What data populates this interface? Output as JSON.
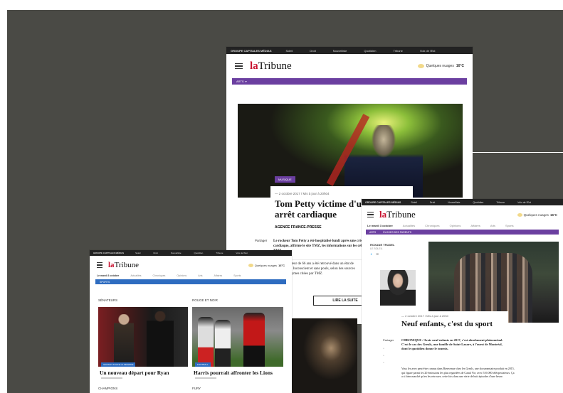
{
  "big": {
    "top_group": "GROUPE CAPITALES MÉDIAS",
    "top_links": [
      "Soleil",
      "Droit",
      "Nouvelliste",
      "Quotidien",
      "Tribune",
      "Voix de l'Est"
    ],
    "logo_la": "la",
    "logo_tribune": "Tribune",
    "weather": "Quelques nuages",
    "temp": "16°C",
    "section": "ARTS",
    "tag": "MUSIQUE",
    "date": "— 2 octobre 2017 / Mis à jour à 20h04",
    "title": "Tom Petty victime d'un arrêt cardiaque",
    "agency": "AGENCE FRANCE-PRESSE",
    "share": "Partager",
    "lead": "Le rockeur Tom Petty a été hospitalisé lundi après une crise cardiaque, affirme le site TMZ, les informations sur les célébrités TMZ.",
    "para": "chanteur de 66 ans a été retrouvé dans un état de arrêt. Inconscient et sans pouls, selon des sources anonymes citées par TMZ.",
    "button": "LIRE LA SUITE"
  },
  "left": {
    "top_group": "GROUPE CAPITALES MÉDIAS",
    "top_links": [
      "Soleil",
      "Droit",
      "Nouvelliste",
      "Quotidien",
      "Tribune",
      "Voix de l'Est"
    ],
    "logo_la": "la",
    "logo_tribune": "Tribune",
    "weather": "Quelques nuages",
    "temp": "16°C",
    "nav": [
      "Le mardi 3 octobre",
      "Actualités",
      "Chroniques",
      "Opinions",
      "Arts",
      "Affaires",
      "Sports"
    ],
    "section": "SPORTS",
    "col1_label": "SÉNATEURS",
    "col2_label": "ROUGE ET NOIR",
    "card1_tag": "GRATUIT TOUTE LA SEMAINE",
    "card2_tag": "FOOTBALL",
    "card1_title": "Un nouveau départ pour Ryan",
    "card2_title": "Harris pourrait affronter les Lions",
    "col1_bottom": "CHAMPIONS",
    "col2_bottom": "FURY"
  },
  "right": {
    "top_group": "GROUPE CAPITALES MÉDIAS",
    "top_links": [
      "Soleil",
      "Droit",
      "Nouvelliste",
      "Quotidien",
      "Tribune",
      "Voix de l'Est"
    ],
    "logo_la": "la",
    "logo_tribune": "Tribune",
    "weather": "Quelques nuages",
    "temp": "16°C",
    "nav": [
      "Le mardi 3 octobre",
      "Actualités",
      "Chroniques",
      "Opinions",
      "Affaires",
      "Arts",
      "Sports"
    ],
    "section1": "ARTS",
    "section2": "ÉLOGES DES PARENTS",
    "author": "ROXANE TRUDEL",
    "author_org": "LE SOLEIL",
    "date": "— 2 octobre 2017 / Mis à jour à 20h0",
    "title": "Neuf enfants, c'est du sport",
    "share": "Partager",
    "lead": "CHRONIQUE / Avoir neuf enfants en 2017, c'est absolument phénoménal. C'est le cas des Greals, une famille de Saint-Lazare, à l'ouest de Montréal, dont le quotidien donne le tournis.",
    "para": "Vous les avez peut-être connus dans Bienvenue chez les Greals, une documentaire produit en 2015, qui figure parmi les 20 émissions les plus regardées de Canal Vie, avec 516 000 téléspectateurs. Ça a si bien marché qu'en les retrouve, cette fois dans une série de huit épisodes d'une heure."
  }
}
